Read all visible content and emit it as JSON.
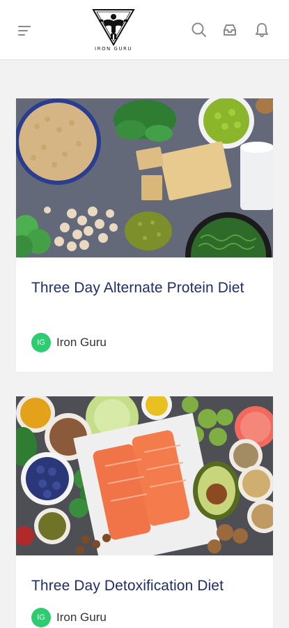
{
  "header": {
    "logo_text": "IRON GURU",
    "icons": [
      "menu-icon",
      "search-icon",
      "inbox-icon",
      "bell-icon"
    ]
  },
  "colors": {
    "title": "#1f2d68",
    "avatar": "#2ecc71",
    "background": "#f2f2f2"
  },
  "articles": [
    {
      "title": "Three Day Alternate Protein Diet",
      "author_initials": "IG",
      "author_name": "Iron Guru",
      "image": "protein foods: soybeans, tofu, chickpeas, peas, seaweed, milk"
    },
    {
      "title": "Three Day Detoxification Diet",
      "author_initials": "IG",
      "author_name": "Iron Guru",
      "image": "salmon fillets, avocado, blueberries, broccoli, grains, vegetables"
    }
  ]
}
